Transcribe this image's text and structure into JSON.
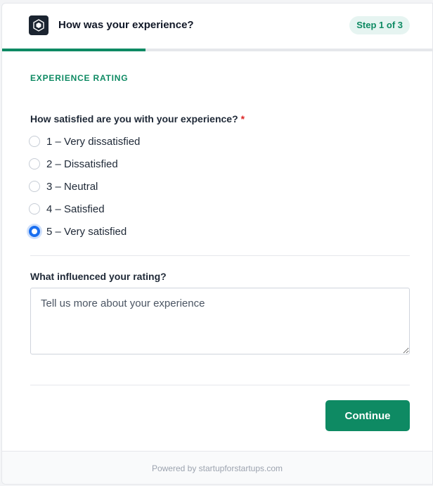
{
  "header": {
    "title": "How was your experience?",
    "step_badge": "Step 1 of 3",
    "progress_fraction": 0.333,
    "accent_color": "#0e8a63"
  },
  "section": {
    "label": "EXPERIENCE RATING"
  },
  "rating": {
    "question": "How satisfied are you with your experience?",
    "required_mark": "*",
    "selected_index": 4,
    "options": [
      {
        "label": "1 – Very dissatisfied"
      },
      {
        "label": "2 – Dissatisfied"
      },
      {
        "label": "3 – Neutral"
      },
      {
        "label": "4 – Satisfied"
      },
      {
        "label": "5 – Very satisfied"
      }
    ]
  },
  "influence": {
    "label": "What influenced your rating?",
    "placeholder": "Tell us more about your experience",
    "value": ""
  },
  "actions": {
    "continue_label": "Continue"
  },
  "footer": {
    "text": "Powered by startupforstartups.com"
  }
}
